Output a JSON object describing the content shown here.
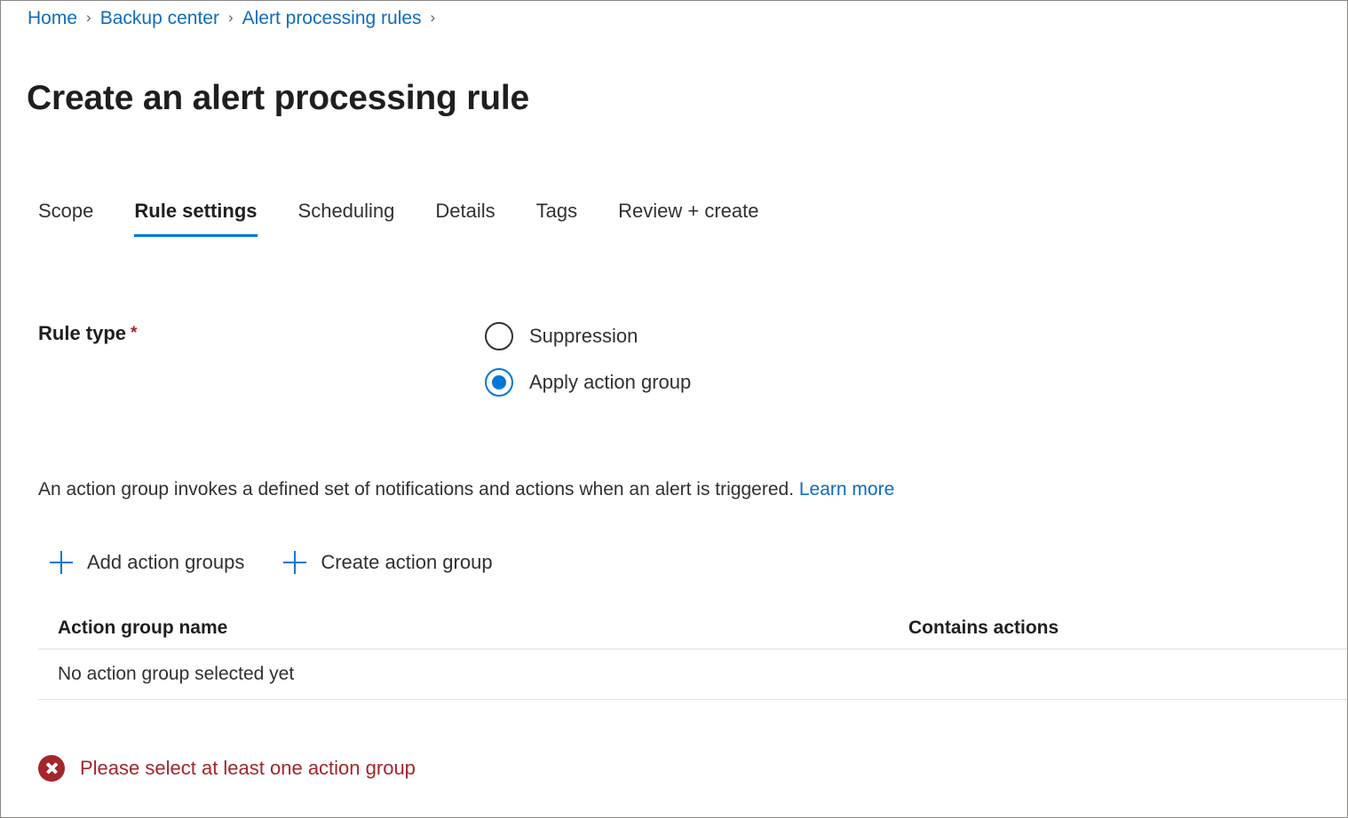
{
  "breadcrumb": {
    "separator": "›",
    "items": [
      {
        "label": "Home"
      },
      {
        "label": "Backup center"
      },
      {
        "label": "Alert processing rules"
      }
    ]
  },
  "header": {
    "title": "Create an alert processing rule"
  },
  "tabs": [
    {
      "label": "Scope",
      "active": false
    },
    {
      "label": "Rule settings",
      "active": true
    },
    {
      "label": "Scheduling",
      "active": false
    },
    {
      "label": "Details",
      "active": false
    },
    {
      "label": "Tags",
      "active": false
    },
    {
      "label": "Review + create",
      "active": false
    }
  ],
  "rule_type": {
    "label": "Rule type",
    "required_marker": "*",
    "options": [
      {
        "label": "Suppression",
        "selected": false
      },
      {
        "label": "Apply action group",
        "selected": true
      }
    ]
  },
  "description": {
    "text": "An action group invokes a defined set of notifications and actions when an alert is triggered.",
    "link_label": "Learn more"
  },
  "commands": [
    {
      "label": "Add action groups",
      "icon": "plus-icon"
    },
    {
      "label": "Create action group",
      "icon": "plus-icon"
    }
  ],
  "grid": {
    "columns": [
      {
        "label": "Action group name"
      },
      {
        "label": "Contains actions"
      }
    ],
    "empty_state": "No action group selected yet",
    "rows": []
  },
  "validation": {
    "icon": "error-circle-x-icon",
    "message": "Please select at least one action group"
  },
  "colors": {
    "accent": "#0078d4",
    "link": "#0f6cbd",
    "error": "#a4262c",
    "text": "#323130",
    "text_strong": "#201f1e",
    "divider": "#e1dfdd",
    "page_border": "#8a8886"
  }
}
